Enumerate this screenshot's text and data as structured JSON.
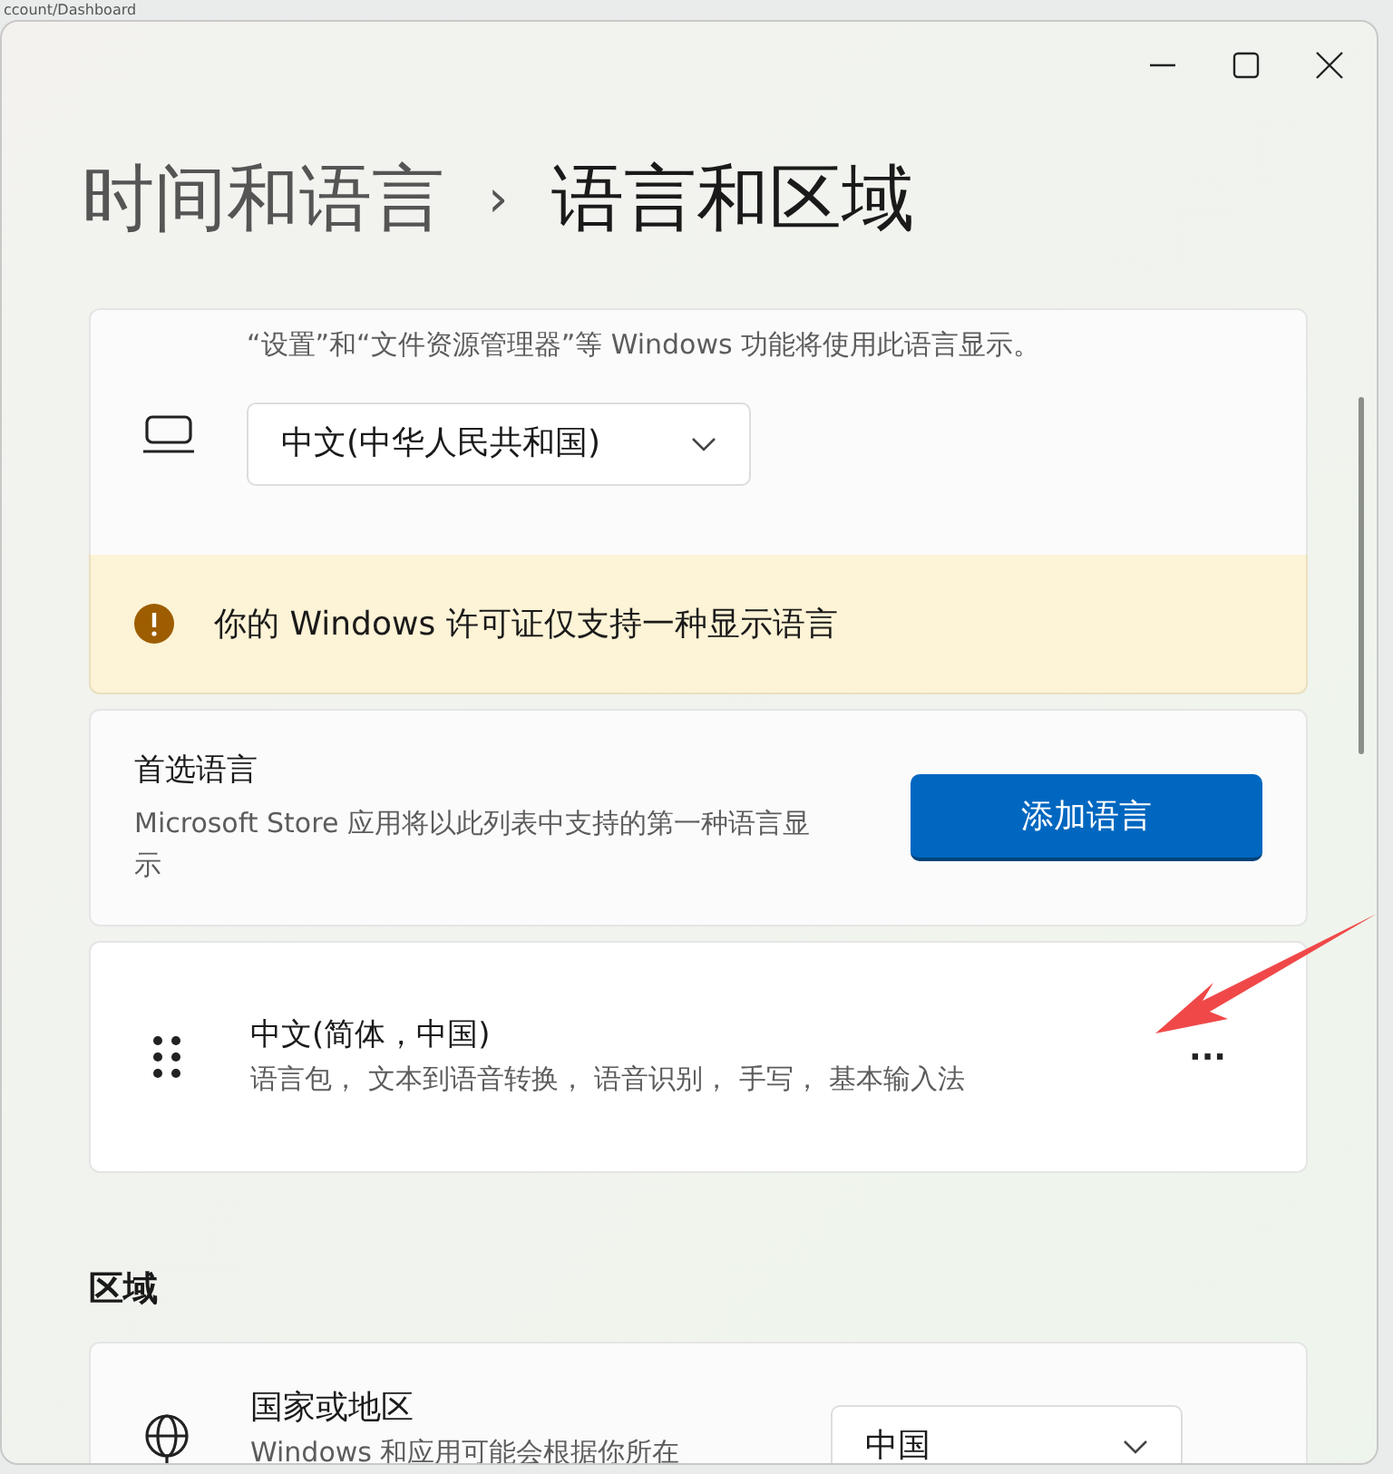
{
  "background": {
    "text": "ccount/Dashboard"
  },
  "window": {
    "breadcrumb": {
      "parent": "时间和语言",
      "separator": "›",
      "current": "语言和区域"
    }
  },
  "display_language": {
    "description": "“设置”和“文件资源管理器”等 Windows 功能将使用此语言显示。",
    "dropdown": {
      "value": "中文(中华人民共和国)"
    }
  },
  "warning": {
    "text": "你的 Windows 许可证仅支持一种显示语言"
  },
  "preferred_languages": {
    "title": "首选语言",
    "description": "Microsoft Store 应用将以此列表中支持的第一种语言显示",
    "button": "添加语言"
  },
  "languages": [
    {
      "name": "中文(简体，中国)",
      "features": "语言包， 文本到语音转换， 语音识别， 手写， 基本输入法",
      "more": "···"
    }
  ],
  "region": {
    "heading": "区域",
    "country": {
      "title": "国家或地区",
      "description": "Windows 和应用可能会根据你所在",
      "dropdown": {
        "value": "中国"
      }
    }
  }
}
